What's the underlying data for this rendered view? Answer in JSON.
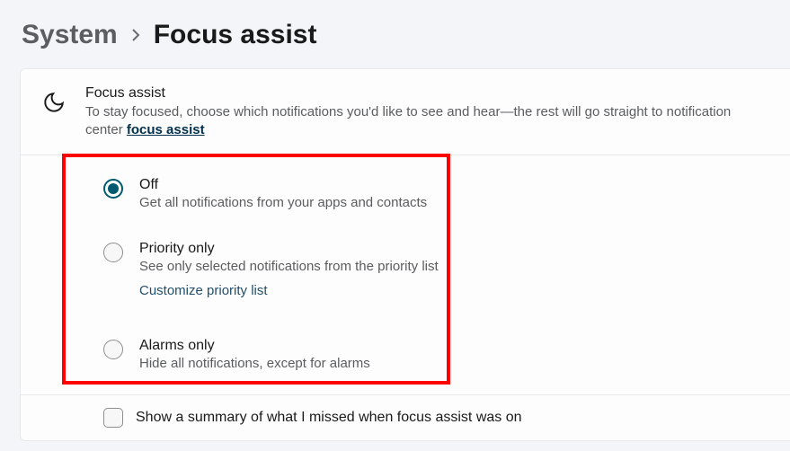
{
  "breadcrumb": {
    "parent": "System",
    "title": "Focus assist"
  },
  "intro": {
    "title": "Focus assist",
    "description": "To stay focused, choose which notifications you'd like to see and hear—the rest will go straight to notification center",
    "link_label": "focus assist"
  },
  "options": [
    {
      "id": "off",
      "title": "Off",
      "description": "Get all notifications from your apps and contacts",
      "selected": true
    },
    {
      "id": "priority",
      "title": "Priority only",
      "description": "See only selected notifications from the priority list",
      "selected": false,
      "customize_label": "Customize priority list"
    },
    {
      "id": "alarms",
      "title": "Alarms only",
      "description": "Hide all notifications, except for alarms",
      "selected": false
    }
  ],
  "summary": {
    "label": "Show a summary of what I missed when focus assist was on",
    "checked": false
  },
  "highlight": {
    "color": "#ff0000"
  }
}
